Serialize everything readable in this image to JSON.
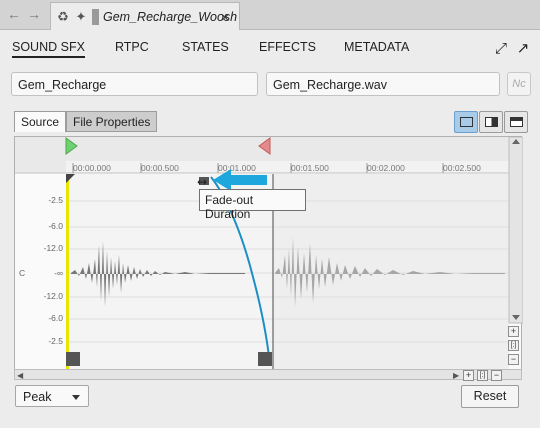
{
  "titlebar": {
    "back_icon": "arrow-left-icon",
    "forward_icon": "arrow-right-icon",
    "tab_name": "Gem_Recharge_Woosh",
    "close_glyph": "×"
  },
  "tabs": [
    "SOUND SFX",
    "RTPC",
    "STATES",
    "EFFECTS",
    "METADATA"
  ],
  "object_name": "Gem_Recharge",
  "source_file": "Gem_Recharge.wav",
  "notes_button": "Nc",
  "subtabs": [
    "Source",
    "File Properties"
  ],
  "timeline": [
    "00:00.000",
    "00:00.500",
    "00:01.000",
    "00:01.500",
    "00:02.000",
    "00:02.500"
  ],
  "db_scale_top": [
    "-2.5",
    "-6.0",
    "-12.0"
  ],
  "db_center": "-∞",
  "db_scale_bottom": [
    "-12.0",
    "-6.0",
    "-2.5"
  ],
  "channel_label": "C",
  "tooltip": "Fade-out Duration",
  "zoom_controls": {
    "plus": "+",
    "fit": "[:]",
    "minus": "−"
  },
  "meter_mode": "Peak",
  "reset_label": "Reset",
  "colors": {
    "trim_start": "#e6e600",
    "trim_end": "#777777",
    "fade_curve": "#1b8ec6",
    "marker_start": "#6fd16f",
    "marker_end": "#e58a8a",
    "pointer_arrow": "#1ea7dd",
    "active_view_button": "#a8cbe9"
  }
}
